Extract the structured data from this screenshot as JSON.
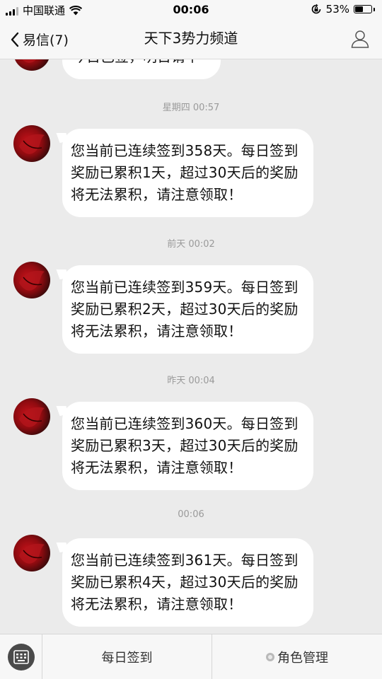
{
  "status_bar": {
    "carrier": "中国联通",
    "time": "00:06",
    "battery": "53%",
    "battery_level": 0.53
  },
  "nav": {
    "back_label": "易信(7)",
    "title": "天下3势力频道"
  },
  "chat": {
    "partial_message": "今日已签，明日请早",
    "messages": [
      {
        "timestamp": "星期四 00:57",
        "text": "您当前已连续签到358天。每日签到奖励已累积1天，超过30天后的奖励将无法累积，请注意领取！"
      },
      {
        "timestamp": "前天 00:02",
        "text": "您当前已连续签到359天。每日签到奖励已累积2天，超过30天后的奖励将无法累积，请注意领取！"
      },
      {
        "timestamp": "昨天 00:04",
        "text": "您当前已连续签到360天。每日签到奖励已累积3天，超过30天后的奖励将无法累积，请注意领取！"
      },
      {
        "timestamp": "00:06",
        "text": "您当前已连续签到361天。每日签到奖励已累积4天，超过30天后的奖励将无法累积，请注意领取！"
      }
    ]
  },
  "bottom_bar": {
    "daily_checkin": "每日签到",
    "role_manage": "角色管理"
  },
  "icons": {
    "back": "chevron-left-icon",
    "profile": "person-icon",
    "keyboard": "keyboard-icon",
    "role": "dot-icon"
  },
  "colors": {
    "background": "#ebebeb",
    "bubble": "#ffffff",
    "bar": "#f7f7f7",
    "timestamp": "#9a9a9a"
  }
}
